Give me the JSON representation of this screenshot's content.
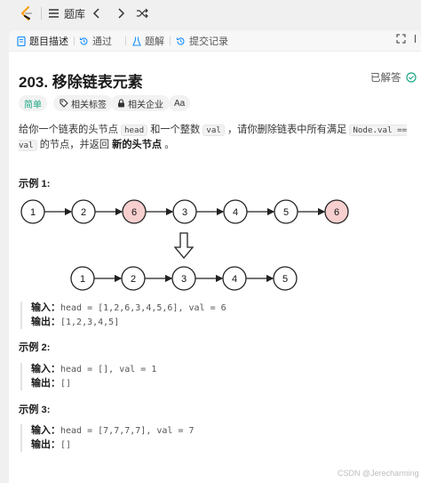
{
  "nav": {
    "title": "题库"
  },
  "tabs": [
    {
      "label": "题目描述"
    },
    {
      "label": "通过"
    },
    {
      "label": "题解"
    },
    {
      "label": "提交记录"
    }
  ],
  "problem": {
    "title": "203. 移除链表元素",
    "status": "已解答",
    "tags": {
      "difficulty": "简单",
      "topics": "相关标签",
      "companies": "相关企业",
      "font": "Aa"
    },
    "desc": {
      "p1": "给你一个链表的头节点 ",
      "c1": "head",
      "p2": " 和一个整数 ",
      "c2": "val",
      "p3": " ，请你删除链表中所有满足 ",
      "c3": "Node.val == val",
      "p4": " 的节点，并返回 ",
      "bold": "新的头节点",
      "p5": " 。"
    }
  },
  "examples": [
    {
      "title": "示例 1:",
      "input_label": "输入：",
      "input": "head = [1,2,6,3,4,5,6], val = 6",
      "output_label": "输出：",
      "output": "[1,2,3,4,5]"
    },
    {
      "title": "示例 2:",
      "input_label": "输入：",
      "input": "head = [], val = 1",
      "output_label": "输出：",
      "output": "[]"
    },
    {
      "title": "示例 3:",
      "input_label": "输入：",
      "input": "head = [7,7,7,7], val = 7",
      "output_label": "输出：",
      "output": "[]"
    }
  ],
  "diagram": {
    "before": [
      "1",
      "2",
      "6",
      "3",
      "4",
      "5",
      "6"
    ],
    "after": [
      "1",
      "2",
      "3",
      "4",
      "5"
    ],
    "highlight_color": "#f7cfcf"
  },
  "watermark": "CSDN @Jerecharming",
  "colors": {
    "easy": "#1ba784",
    "accent": "#1a90ff"
  }
}
